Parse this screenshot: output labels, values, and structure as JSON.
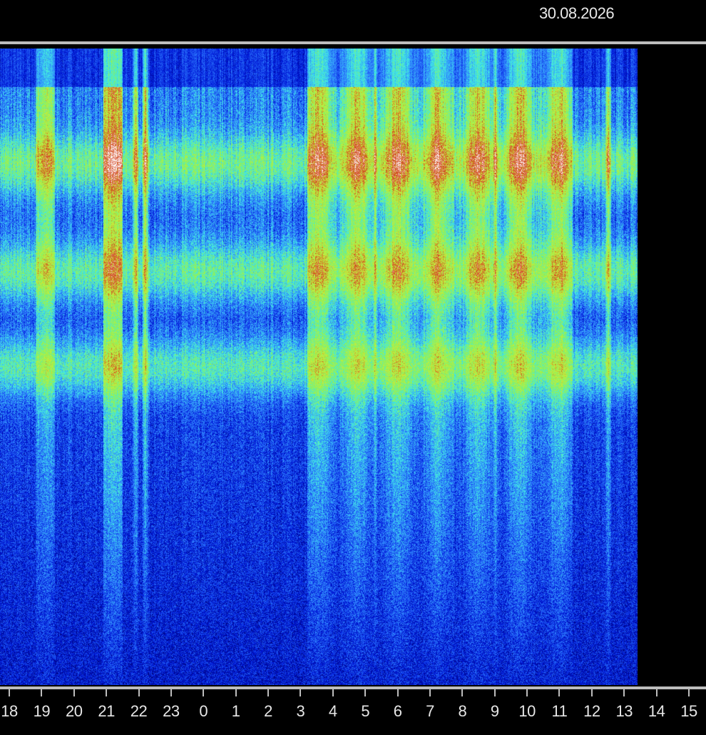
{
  "header": {
    "date": "30.08.2026"
  },
  "chart_data": {
    "type": "heatmap",
    "x_unit_shown": "hour of day",
    "tick_labels": [
      "18",
      "19",
      "20",
      "21",
      "22",
      "23",
      "0",
      "1",
      "2",
      "3",
      "4",
      "5",
      "6",
      "7",
      "8",
      "9",
      "10",
      "11",
      "12",
      "13",
      "14",
      "15"
    ],
    "x_range_hours": [
      17.7,
      15.2
    ],
    "data_ends_at_hour": 13.4,
    "colormap": [
      "#00006e",
      "#0018d8",
      "#2e7cff",
      "#3fe8e8",
      "#8cf25a",
      "#c8ec3a",
      "#d23c1c",
      "#ffffff"
    ],
    "intensity_scale": "0 = quiet (dark blue) to 1 = saturated (white)",
    "horizontal_bands_relative_height": [
      0.18,
      0.35,
      0.5
    ],
    "high_activity_hours": [
      {
        "from": 3.2,
        "to": 11.4,
        "level": 0.85
      },
      {
        "from": 20.9,
        "to": 21.5,
        "level": 0.95
      },
      {
        "from": 18.8,
        "to": 19.4,
        "level": 0.7
      }
    ],
    "vertical_spikes_hours": [
      21.9,
      22.2,
      5.3,
      9.0,
      12.5,
      3.4
    ],
    "grid": false
  }
}
